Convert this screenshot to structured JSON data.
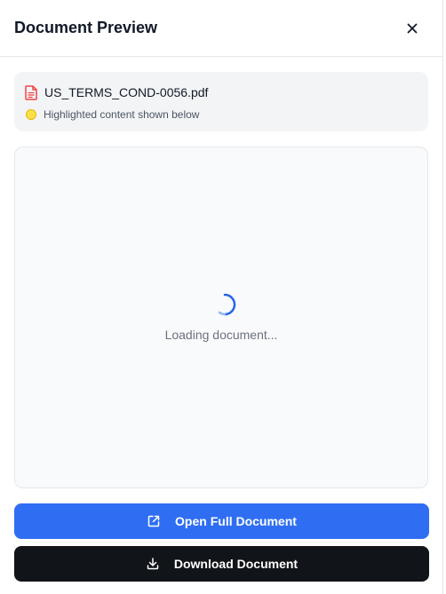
{
  "header": {
    "title": "Document Preview",
    "close_icon": "close-icon"
  },
  "file": {
    "name": "US_TERMS_COND-0056.pdf",
    "icon": "pdf-file-icon",
    "icon_color": "#ef4444",
    "highlight_note": "Highlighted content shown below",
    "highlight_color": "#fde047"
  },
  "viewer": {
    "loading_text": "Loading document..."
  },
  "actions": {
    "open_label": "Open Full Document",
    "open_icon": "external-link-icon",
    "open_color": "#2f6ef3",
    "download_label": "Download Document",
    "download_icon": "download-icon",
    "download_color": "#111418"
  }
}
